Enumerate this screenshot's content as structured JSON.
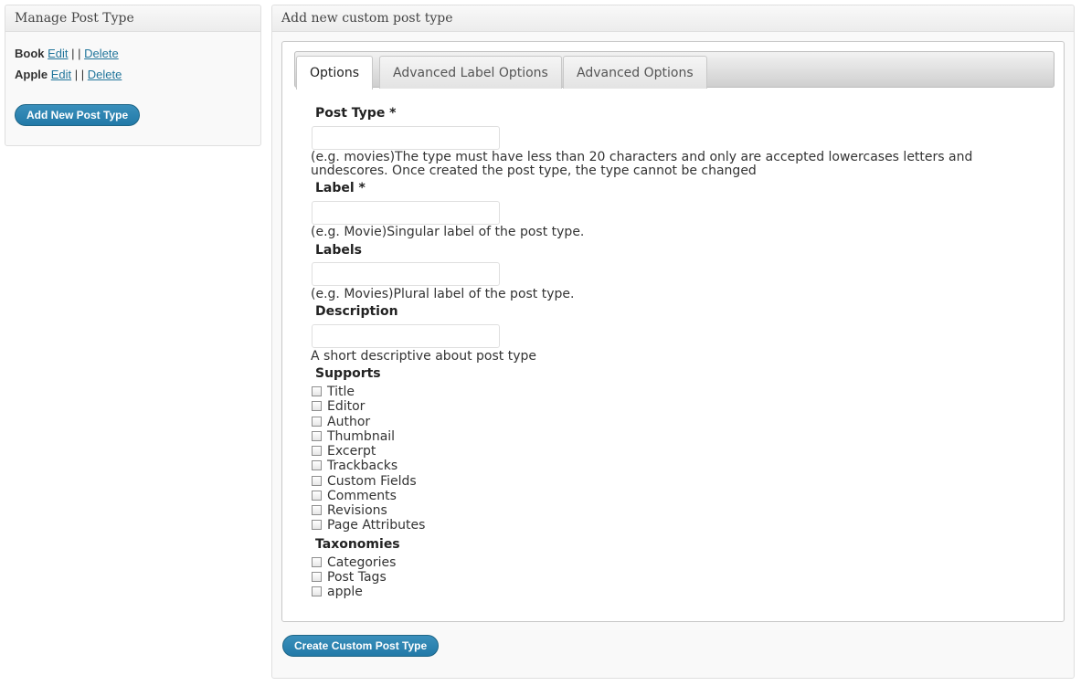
{
  "manage": {
    "title": "Manage Post Type",
    "post_types": [
      {
        "name": "Book",
        "edit": "Edit",
        "sep": "| |",
        "delete": "Delete"
      },
      {
        "name": "Apple",
        "edit": "Edit",
        "sep": "| |",
        "delete": "Delete"
      }
    ],
    "add_button": "Add New Post Type"
  },
  "form": {
    "title": "Add new custom post type",
    "tabs": [
      "Options",
      "Advanced Label Options",
      "Advanced Options"
    ],
    "active_tab": "Options",
    "post_type": {
      "label": "Post Type *",
      "value": "",
      "hint": "(e.g. movies)The type must have less than 20 characters and only are accepted lowercases letters and undescores. Once created the post type, the type cannot be changed"
    },
    "label": {
      "label": "Label *",
      "value": "",
      "hint": "(e.g. Movie)Singular label of the post type."
    },
    "labels": {
      "label": "Labels",
      "value": "",
      "hint": "(e.g. Movies)Plural label of the post type."
    },
    "description": {
      "label": "Description",
      "value": "",
      "hint": "A short descriptive about post type"
    },
    "supports": {
      "label": "Supports",
      "items": [
        "Title",
        "Editor",
        "Author",
        "Thumbnail",
        "Excerpt",
        "Trackbacks",
        "Custom Fields",
        "Comments",
        "Revisions",
        "Page Attributes"
      ]
    },
    "taxonomies": {
      "label": "Taxonomies",
      "items": [
        "Categories",
        "Post Tags",
        "apple"
      ]
    },
    "submit": "Create Custom Post Type"
  }
}
